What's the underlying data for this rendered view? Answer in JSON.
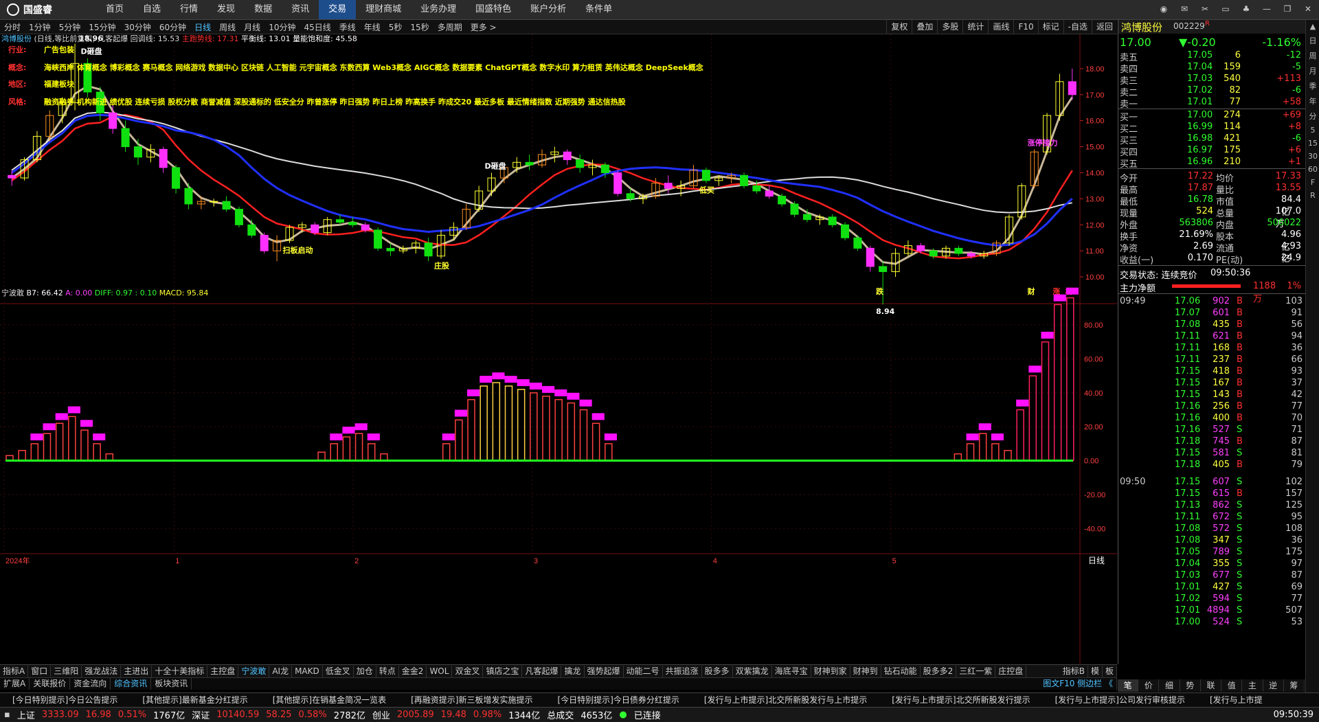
{
  "app": {
    "logo": "国盛睿"
  },
  "menu": [
    "首页",
    "自选",
    "行情",
    "发现",
    "数据",
    "资讯",
    "交易",
    "理财商城",
    "业务办理",
    "国盛特色",
    "账户分析",
    "条件单"
  ],
  "menu_active": 6,
  "periods": [
    "分时",
    "1分钟",
    "5分钟",
    "15分钟",
    "30分钟",
    "60分钟",
    "日线",
    "周线",
    "月线",
    "10分钟",
    "45日线",
    "季线",
    "年线",
    "5秒",
    "15秒",
    "多周期",
    "更多 >"
  ],
  "period_active": 6,
  "right_tools": [
    "复权",
    "叠加",
    "多股",
    "统计",
    "画线",
    "F10",
    "标记",
    "-自选",
    "返回"
  ],
  "main_legend": {
    "name": "鸿博股份",
    "mode": "(日线,等比前复权)",
    "indicator": "凡客起爆",
    "a": "回调线: 15.53",
    "b": "主跑势线: 17.31",
    "c": "平衡线: 13.01",
    "d": "量能饱和度: 45.58"
  },
  "info_labels": {
    "industry_k": "行业:",
    "industry_v": "广告包装",
    "concept_k": "概念:",
    "concept_v": "海峡西岸 体育概念 博彩概念 赛马概念 网络游戏 数据中心 区块链 人工智能 元宇宙概念 东数西算 Web3概念 AIGC概念 数据要素 ChatGPT概念 数字水印 算力租赁 英伟达概念 DeepSeek概念",
    "region_k": "地区:",
    "region_v": "福建板块",
    "style_k": "风格:",
    "style_v": "融资融券 机构新进 绩优股 连续亏损 股权分散 商誉减值 深股通标的 低安全分 昨曾涨停 昨日强势 昨日上榜 昨高换手 昨成交20 最近多板 最近情绪指数 近期强势 通达信热股"
  },
  "chart_data": [
    {
      "type": "candlestick",
      "title": "鸿博股份",
      "ylim": [
        9.5,
        19.0
      ],
      "y_ticks": [
        "18.00",
        "17.00",
        "16.00",
        "15.00",
        "14.00",
        "13.00",
        "12.00",
        "11.00",
        "10.00"
      ],
      "x_ticks": [
        "2024年",
        "1",
        "2",
        "3",
        "4",
        "5"
      ],
      "series": [
        {
          "name": "回调线",
          "color": "#c8b89a"
        },
        {
          "name": "主跑势线",
          "color": "#ff2020"
        },
        {
          "name": "平衡线",
          "color": "#dddddd"
        },
        {
          "name": "量能饱和度",
          "color": "#2030ff"
        }
      ],
      "annotations": [
        "D砸盘",
        "18.96",
        "D砸盘",
        "8.94",
        "扫板启动",
        "庄股",
        "低买",
        "涨停接力",
        "跌",
        "财",
        "涨",
        "榜"
      ],
      "ohlc": [
        [
          13.9,
          14.1,
          13.5,
          13.8
        ],
        [
          13.8,
          14.6,
          13.7,
          14.5
        ],
        [
          14.5,
          15.6,
          14.4,
          15.4
        ],
        [
          15.4,
          16.4,
          15.2,
          16.2
        ],
        [
          16.2,
          16.9,
          15.9,
          16.7
        ],
        [
          16.7,
          18.96,
          16.4,
          18.2
        ],
        [
          18.2,
          18.4,
          16.9,
          17.1
        ],
        [
          17.1,
          17.3,
          16.0,
          16.3
        ],
        [
          16.3,
          16.6,
          15.5,
          15.7
        ],
        [
          15.7,
          16.0,
          14.8,
          15.0
        ],
        [
          15.0,
          15.3,
          14.3,
          14.6
        ],
        [
          14.6,
          15.1,
          14.4,
          14.9
        ],
        [
          14.9,
          15.0,
          14.0,
          14.2
        ],
        [
          14.2,
          14.3,
          13.2,
          13.4
        ],
        [
          13.4,
          13.6,
          12.6,
          12.8
        ],
        [
          12.8,
          13.1,
          12.6,
          12.9
        ],
        [
          12.9,
          13.0,
          12.7,
          12.9
        ],
        [
          12.9,
          13.1,
          12.5,
          12.6
        ],
        [
          12.6,
          12.7,
          11.9,
          12.0
        ],
        [
          12.0,
          12.2,
          11.5,
          11.6
        ],
        [
          11.6,
          11.7,
          10.9,
          11.0
        ],
        [
          11.0,
          11.6,
          10.6,
          11.4
        ],
        [
          11.4,
          12.0,
          11.3,
          11.9
        ],
        [
          11.9,
          12.1,
          11.7,
          12.0
        ],
        [
          12.0,
          12.1,
          11.6,
          11.7
        ],
        [
          11.7,
          12.3,
          11.6,
          12.2
        ],
        [
          12.2,
          12.4,
          12.0,
          12.1
        ],
        [
          12.1,
          12.3,
          11.9,
          12.0
        ],
        [
          12.0,
          12.1,
          11.7,
          11.8
        ],
        [
          11.8,
          11.9,
          11.0,
          11.1
        ],
        [
          11.1,
          11.3,
          10.8,
          11.0
        ],
        [
          11.0,
          11.2,
          10.9,
          11.1
        ],
        [
          11.1,
          11.4,
          10.9,
          11.3
        ],
        [
          11.3,
          11.5,
          10.6,
          10.8
        ],
        [
          10.8,
          11.8,
          10.7,
          11.6
        ],
        [
          11.6,
          12.1,
          11.4,
          11.9
        ],
        [
          11.9,
          12.8,
          11.8,
          12.6
        ],
        [
          12.6,
          13.5,
          12.5,
          13.3
        ],
        [
          13.3,
          14.0,
          13.1,
          13.8
        ],
        [
          13.8,
          14.4,
          13.6,
          14.2
        ],
        [
          14.2,
          14.6,
          14.0,
          14.4
        ],
        [
          14.4,
          14.7,
          14.1,
          14.3
        ],
        [
          14.3,
          14.9,
          14.2,
          14.7
        ],
        [
          14.7,
          15.0,
          14.4,
          14.8
        ],
        [
          14.8,
          14.9,
          14.3,
          14.5
        ],
        [
          14.5,
          14.7,
          14.0,
          14.2
        ],
        [
          14.2,
          14.5,
          13.9,
          14.3
        ],
        [
          14.3,
          14.4,
          13.8,
          14.0
        ],
        [
          14.0,
          14.1,
          13.1,
          13.2
        ],
        [
          13.2,
          13.4,
          12.9,
          13.0
        ],
        [
          13.0,
          13.2,
          12.8,
          13.1
        ],
        [
          13.1,
          13.8,
          13.0,
          13.6
        ],
        [
          13.6,
          13.9,
          13.2,
          13.4
        ],
        [
          13.4,
          13.7,
          13.1,
          13.5
        ],
        [
          13.5,
          14.3,
          13.4,
          14.1
        ],
        [
          14.1,
          14.2,
          13.6,
          13.7
        ],
        [
          13.7,
          13.9,
          13.5,
          13.8
        ],
        [
          13.8,
          14.0,
          13.6,
          13.9
        ],
        [
          13.9,
          14.0,
          13.4,
          13.5
        ],
        [
          13.5,
          13.7,
          13.2,
          13.3
        ],
        [
          13.3,
          13.5,
          13.0,
          13.1
        ],
        [
          13.1,
          13.2,
          12.7,
          12.8
        ],
        [
          12.8,
          12.9,
          12.3,
          12.4
        ],
        [
          12.4,
          12.6,
          12.1,
          12.2
        ],
        [
          12.2,
          12.4,
          12.0,
          12.3
        ],
        [
          12.3,
          12.4,
          11.9,
          12.0
        ],
        [
          12.0,
          12.1,
          11.4,
          11.5
        ],
        [
          11.5,
          11.6,
          11.0,
          11.1
        ],
        [
          11.1,
          11.2,
          10.2,
          10.4
        ],
        [
          10.4,
          10.6,
          8.94,
          10.2
        ],
        [
          10.2,
          11.1,
          10.0,
          10.9
        ],
        [
          10.9,
          11.4,
          10.8,
          11.2
        ],
        [
          11.2,
          11.3,
          10.9,
          11.0
        ],
        [
          11.0,
          11.1,
          10.7,
          10.8
        ],
        [
          10.8,
          11.2,
          10.7,
          11.1
        ],
        [
          11.1,
          11.2,
          10.8,
          10.9
        ],
        [
          10.9,
          11.0,
          10.7,
          10.8
        ],
        [
          10.8,
          11.0,
          10.7,
          10.9
        ],
        [
          10.9,
          11.4,
          10.8,
          11.3
        ],
        [
          11.3,
          12.4,
          11.2,
          12.3
        ],
        [
          12.3,
          13.6,
          12.2,
          13.5
        ],
        [
          13.5,
          14.9,
          13.4,
          14.8
        ],
        [
          14.8,
          16.3,
          14.7,
          16.2
        ],
        [
          16.2,
          17.8,
          16.0,
          17.5
        ],
        [
          17.5,
          18.0,
          16.8,
          17.0
        ]
      ]
    },
    {
      "type": "bar",
      "title": "宁波敢",
      "legend": {
        "a": "B7: 66.42",
        "b": "A: 0.00",
        "c": "DIFF: 0.97",
        "d": ": 0.10",
        "e": "MACD: 95.84"
      },
      "ylim": [
        -50,
        95
      ],
      "y_ticks": [
        "80.00",
        "60.00",
        "40.00",
        "20.00",
        "0.00",
        "-20.00",
        "-40.00"
      ],
      "values": [
        3,
        6,
        10,
        16,
        22,
        26,
        18,
        10,
        4,
        0,
        0,
        0,
        0,
        0,
        0,
        0,
        0,
        0,
        0,
        0,
        0,
        0,
        0,
        0,
        0,
        5,
        10,
        14,
        16,
        10,
        4,
        0,
        0,
        0,
        0,
        10,
        24,
        36,
        44,
        46,
        44,
        42,
        40,
        38,
        36,
        34,
        30,
        22,
        10,
        0,
        0,
        0,
        0,
        0,
        0,
        0,
        0,
        0,
        0,
        0,
        0,
        0,
        0,
        0,
        0,
        0,
        0,
        0,
        0,
        0,
        0,
        0,
        0,
        0,
        0,
        0,
        4,
        10,
        16,
        10,
        6,
        30,
        50,
        70,
        92,
        96
      ]
    }
  ],
  "right_panel": {
    "stock_name": "鸿博股份",
    "stock_code": "002229",
    "tag": "R",
    "price": "17.00",
    "change": "▼-0.20",
    "pct": "-1.16%",
    "asks": [
      {
        "label": "卖五",
        "price": "17.05",
        "vol": "6",
        "chg": "-12"
      },
      {
        "label": "卖四",
        "price": "17.04",
        "vol": "159",
        "chg": "-5"
      },
      {
        "label": "卖三",
        "price": "17.03",
        "vol": "540",
        "chg": "+113"
      },
      {
        "label": "卖二",
        "price": "17.02",
        "vol": "82",
        "chg": "-6"
      },
      {
        "label": "卖一",
        "price": "17.01",
        "vol": "77",
        "chg": "+58"
      }
    ],
    "bids": [
      {
        "label": "买一",
        "price": "17.00",
        "vol": "274",
        "chg": "+69"
      },
      {
        "label": "买二",
        "price": "16.99",
        "vol": "114",
        "chg": "+8"
      },
      {
        "label": "买三",
        "price": "16.98",
        "vol": "421",
        "chg": "-6"
      },
      {
        "label": "买四",
        "price": "16.97",
        "vol": "175",
        "chg": "+6"
      },
      {
        "label": "买五",
        "price": "16.96",
        "vol": "210",
        "chg": "+1"
      }
    ],
    "stats": [
      {
        "k1": "今开",
        "v1": "17.22",
        "k2": "均价",
        "v2": "17.33"
      },
      {
        "k1": "最高",
        "v1": "17.87",
        "k2": "量比",
        "v2": "13.55"
      },
      {
        "k1": "最低",
        "v1": "16.78",
        "k2": "市值",
        "v2": "84.4亿"
      },
      {
        "k1": "现量",
        "v1": "524",
        "k2": "总量",
        "v2": "107.0万"
      },
      {
        "k1": "外盘",
        "v1": "563806",
        "k2": "内盘",
        "v2": "506022"
      },
      {
        "k1": "换手",
        "v1": "21.69%",
        "k2": "股本",
        "v2": "4.96亿"
      },
      {
        "k1": "净资",
        "v1": "2.69",
        "k2": "流通",
        "v2": "4.93亿"
      },
      {
        "k1": "收益(一)",
        "v1": "0.170",
        "k2": "PE(动)",
        "v2": "24.9"
      }
    ],
    "trade_state": "交易状态: 连续竞价",
    "trade_time": "09:50:36",
    "main_flow_label": "主力净额",
    "main_flow_val": "1188万",
    "main_flow_pct": "1%",
    "ticks_time1": "09:49",
    "ticks_time2": "09:50",
    "ticks": [
      [
        "17.06",
        "902",
        "B",
        "103"
      ],
      [
        "17.07",
        "601",
        "B",
        "91"
      ],
      [
        "17.08",
        "435",
        "B",
        "56"
      ],
      [
        "17.11",
        "621",
        "B",
        "94"
      ],
      [
        "17.11",
        "168",
        "B",
        "36"
      ],
      [
        "17.11",
        "237",
        "B",
        "66"
      ],
      [
        "17.15",
        "418",
        "B",
        "93"
      ],
      [
        "17.15",
        "167",
        "B",
        "37"
      ],
      [
        "17.15",
        "143",
        "B",
        "42"
      ],
      [
        "17.16",
        "256",
        "B",
        "77"
      ],
      [
        "17.16",
        "400",
        "B",
        "70"
      ],
      [
        "17.16",
        "527",
        "S",
        "71"
      ],
      [
        "17.18",
        "745",
        "B",
        "87"
      ],
      [
        "17.15",
        "581",
        "S",
        "81"
      ],
      [
        "17.18",
        "405",
        "B",
        "79"
      ],
      [
        "17.15",
        "607",
        "S",
        "102"
      ],
      [
        "17.15",
        "615",
        "B",
        "157"
      ],
      [
        "17.13",
        "862",
        "S",
        "125"
      ],
      [
        "17.11",
        "672",
        "S",
        "95"
      ],
      [
        "17.08",
        "572",
        "S",
        "108"
      ],
      [
        "17.08",
        "347",
        "S",
        "36"
      ],
      [
        "17.05",
        "789",
        "S",
        "175"
      ],
      [
        "17.04",
        "355",
        "S",
        "97"
      ],
      [
        "17.03",
        "677",
        "S",
        "87"
      ],
      [
        "17.01",
        "427",
        "S",
        "69"
      ],
      [
        "17.02",
        "594",
        "S",
        "77"
      ],
      [
        "17.01",
        "4894",
        "S",
        "507"
      ],
      [
        "17.00",
        "524",
        "S",
        "53"
      ]
    ]
  },
  "sidebar": [
    "日",
    "周",
    "月",
    "季",
    "年",
    "分",
    "5",
    "15",
    "30",
    "60",
    "F",
    "R"
  ],
  "indicator_tabs": [
    "指标A",
    "窗口",
    "三维阳",
    "强龙战法",
    "主进出",
    "十全十美指标",
    "主控盘",
    "宁波敢",
    "AI龙",
    "MAKD",
    "低金叉",
    "加仓",
    "转点",
    "金金2",
    "WOL",
    "双金叉",
    "镇店之宝",
    "凡客起爆",
    "擒龙",
    "强势起爆",
    "动能二号",
    "共振追涨",
    "股多多",
    "双紫擒龙",
    "海底寻宝",
    "财神到家",
    "财神到",
    "钻石动能",
    "股多多2",
    "三红一紫",
    "庄控盘"
  ],
  "indicator_active": 7,
  "indicator_right": [
    "指标B",
    "模",
    "板"
  ],
  "sub_tabs": [
    "扩展A",
    "关联报价",
    "资金流向",
    "综合资讯",
    "板块资讯"
  ],
  "sub_active": 3,
  "sub_right": "图文F10 侧边栏 《",
  "right_tabs": [
    "笔",
    "价",
    "细",
    "势",
    "联",
    "值",
    "主",
    "逆",
    "筹"
  ],
  "right_tab_active": 0,
  "daily_label": "日线",
  "news": [
    "[今日特别提示]今日公告提示",
    "[其他提示]最新基金分红提示",
    "[其他提示]在销基金简况一览表",
    "[再融资提示]新三板增发实施提示",
    "[今日特别提示]今日债券分红提示",
    "[发行与上市提示]北交所新股发行与上市提示",
    "[发行与上市提示]北交所新股发行提示",
    "[发行与上市提示]公司发行审核提示",
    "[发行与上市提"
  ],
  "status": {
    "sh_name": "上证",
    "sh_val": "3333.09",
    "sh_chg": "16.98",
    "sh_pct": "0.51%",
    "sh_amt": "1767亿",
    "sz_name": "深证",
    "sz_val": "10140.59",
    "sz_chg": "58.25",
    "sz_pct": "0.58%",
    "sz_amt": "2782亿",
    "cy_name": "创业",
    "cy_val": "2005.89",
    "cy_chg": "19.48",
    "cy_pct": "0.98%",
    "cy_amt": "1344亿",
    "total_label": "总成交",
    "total_val": "4653亿",
    "conn": "已连接",
    "time": "09:50:39"
  },
  "colors": {
    "up": "#ff3030",
    "down": "#00ff00",
    "accent": "#4fc3ff",
    "yellow": "#ffff00",
    "magenta": "#ff00ff"
  }
}
